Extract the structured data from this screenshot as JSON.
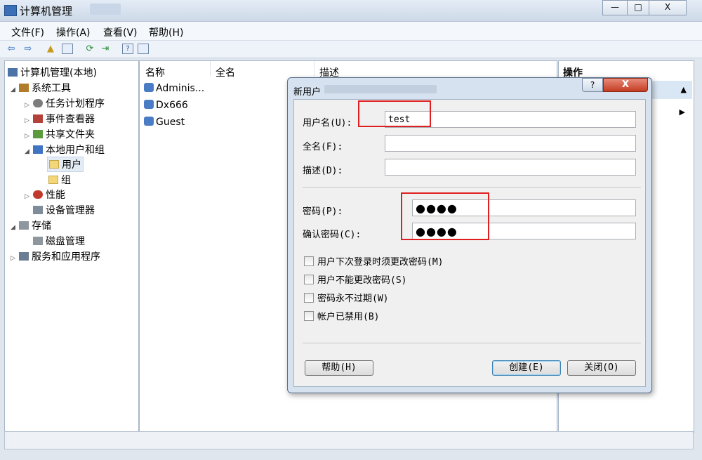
{
  "window": {
    "title": "计算机管理",
    "min": "—",
    "max": "□",
    "close": "X"
  },
  "menu": [
    "文件(F)",
    "操作(A)",
    "查看(V)",
    "帮助(H)"
  ],
  "tree": {
    "root": "计算机管理(本地)",
    "system_tools": "系统工具",
    "task_scheduler": "任务计划程序",
    "event_viewer": "事件查看器",
    "shared_folders": "共享文件夹",
    "local_users_groups": "本地用户和组",
    "users": "用户",
    "groups": "组",
    "performance": "性能",
    "device_manager": "设备管理器",
    "storage": "存储",
    "disk_management": "磁盘管理",
    "services_apps": "服务和应用程序"
  },
  "list": {
    "columns": [
      "名称",
      "全名",
      "描述"
    ],
    "rows": [
      "Adminis...",
      "Dx666",
      "Guest"
    ]
  },
  "actions": {
    "header": "操作"
  },
  "dialog": {
    "title": "新用户",
    "help_glyph": "?",
    "close_glyph": "X",
    "username_label": "用户名(U):",
    "username_value": "test",
    "fullname_label": "全名(F):",
    "fullname_value": "",
    "description_label": "描述(D):",
    "description_value": "",
    "password_label": "密码(P):",
    "password_value": "●●●●",
    "confirm_label": "确认密码(C):",
    "confirm_value": "●●●●",
    "checkboxes": [
      {
        "label": "用户下次登录时须更改密码(M)",
        "checked": false
      },
      {
        "label": "用户不能更改密码(S)",
        "checked": false
      },
      {
        "label": "密码永不过期(W)",
        "checked": false
      },
      {
        "label": "帐户已禁用(B)",
        "checked": false
      }
    ],
    "help_button": "帮助(H)",
    "create_button": "创建(E)",
    "close_button": "关闭(O)"
  }
}
